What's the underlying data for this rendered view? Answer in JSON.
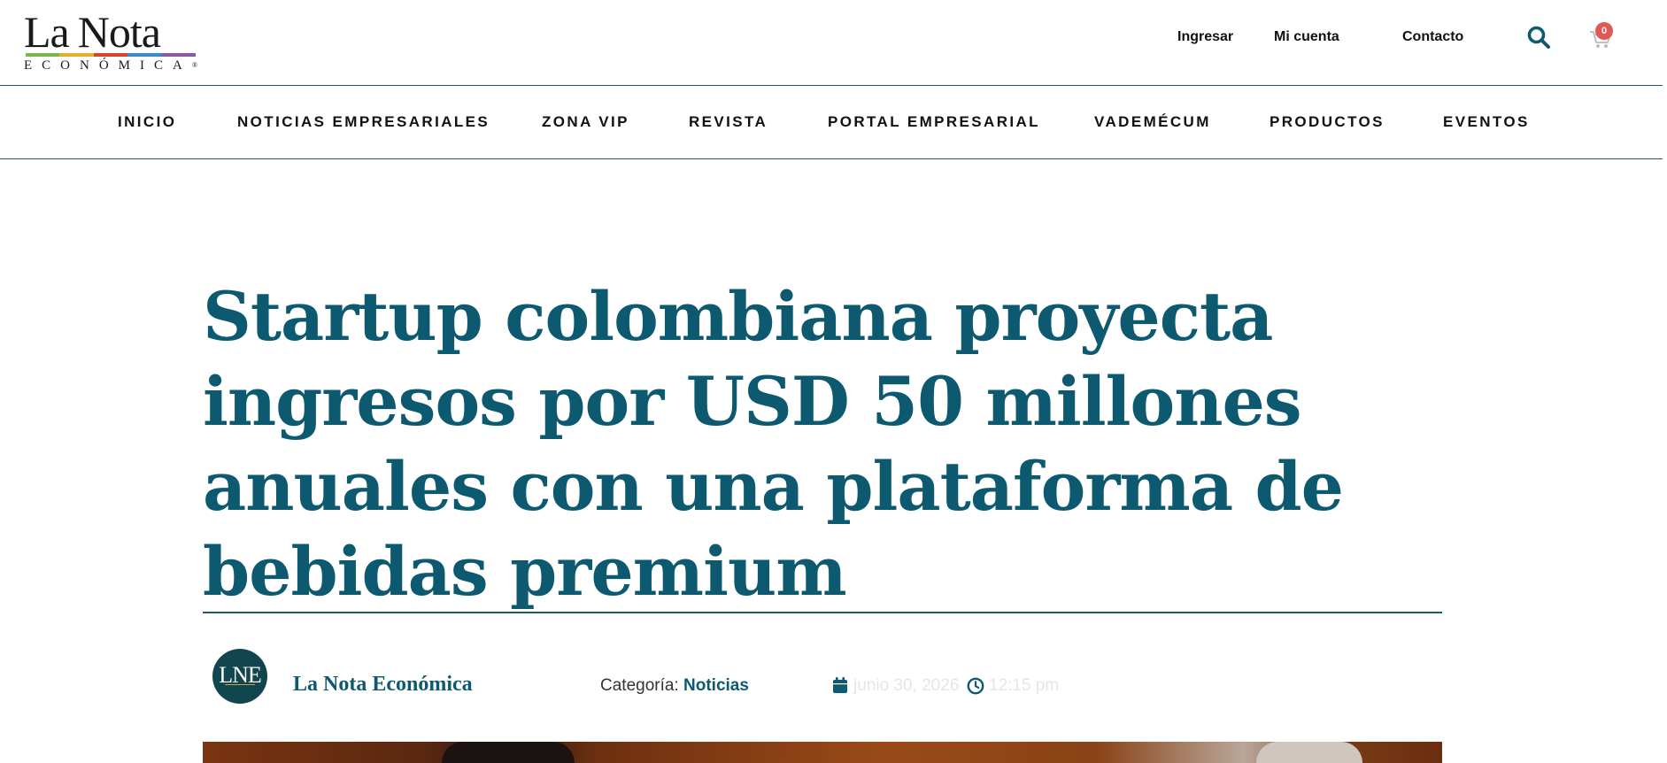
{
  "header": {
    "logo": {
      "main_part1": "La",
      "main_part2": "Nota",
      "sub": "ECONÓMICA",
      "reg_mark": "®",
      "stripe_colors": [
        "#7ab648",
        "#e2b02a",
        "#d8452f",
        "#3a8cc6",
        "#8c5aa0"
      ]
    },
    "links": {
      "login": "Ingresar",
      "account": "Mi cuenta",
      "contact": "Contacto"
    },
    "cart_count": "0",
    "icons": {
      "search": "search-icon",
      "cart": "cart-icon"
    }
  },
  "nav": {
    "items": [
      {
        "label": "INICIO"
      },
      {
        "label": "NOTICIAS EMPRESARIALES"
      },
      {
        "label": "ZONA VIP"
      },
      {
        "label": "REVISTA"
      },
      {
        "label": "PORTAL EMPRESARIAL"
      },
      {
        "label": "VADEMÉCUM"
      },
      {
        "label": "PRODUCTOS"
      },
      {
        "label": "EVENTOS"
      }
    ]
  },
  "article": {
    "title": "Startup colombiana proyecta ingresos por USD 50 millones anuales con una plataforma de bebidas premium",
    "author": {
      "avatar_initials": "LNE",
      "name": "La Nota Económica"
    },
    "category_label": "Categoría:",
    "category_value": "Noticias",
    "date": "junio 30, 2026",
    "time": "12:15 pm",
    "icons": {
      "date": "calendar-icon",
      "time": "clock-icon"
    }
  },
  "colors": {
    "brand_teal": "#0d5a70",
    "rule": "#1f5a68",
    "badge": "#e05a55"
  }
}
